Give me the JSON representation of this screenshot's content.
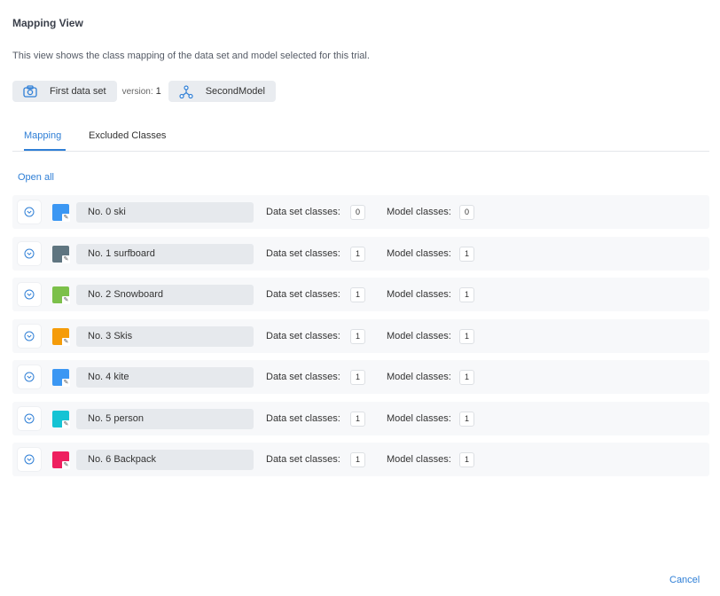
{
  "header": {
    "title": "Mapping View",
    "description": "This view shows the class mapping of the data set and model selected for this trial."
  },
  "chips": {
    "dataset_label": "First data set",
    "version_label": "version:",
    "version_value": "1",
    "model_label": "SecondModel"
  },
  "tabs": [
    {
      "label": "Mapping",
      "active": true
    },
    {
      "label": "Excluded Classes",
      "active": false
    }
  ],
  "open_all_label": "Open all",
  "rows": [
    {
      "name": "No. 0 ski",
      "color": "#3b97f3",
      "ds_label": "Data set classes:",
      "ds_count": "0",
      "model_label": "Model classes:",
      "model_count": "0"
    },
    {
      "name": "No. 1 surfboard",
      "color": "#5f7580",
      "ds_label": "Data set classes:",
      "ds_count": "1",
      "model_label": "Model classes:",
      "model_count": "1"
    },
    {
      "name": "No. 2 Snowboard",
      "color": "#7cc04a",
      "ds_label": "Data set classes:",
      "ds_count": "1",
      "model_label": "Model classes:",
      "model_count": "1"
    },
    {
      "name": "No. 3 Skis",
      "color": "#f59c0a",
      "ds_label": "Data set classes:",
      "ds_count": "1",
      "model_label": "Model classes:",
      "model_count": "1"
    },
    {
      "name": "No. 4 kite",
      "color": "#3b97f3",
      "ds_label": "Data set classes:",
      "ds_count": "1",
      "model_label": "Model classes:",
      "model_count": "1"
    },
    {
      "name": "No. 5 person",
      "color": "#14c3d4",
      "ds_label": "Data set classes:",
      "ds_count": "1",
      "model_label": "Model classes:",
      "model_count": "1"
    },
    {
      "name": "No. 6 Backpack",
      "color": "#ee1f5f",
      "ds_label": "Data set classes:",
      "ds_count": "1",
      "model_label": "Model classes:",
      "model_count": "1"
    }
  ],
  "footer": {
    "cancel_label": "Cancel"
  },
  "icons": {
    "dataset": "camera-icon",
    "model": "network-icon",
    "expand": "chevron-down-circle-icon"
  },
  "accent_color": "#2f7fd6"
}
